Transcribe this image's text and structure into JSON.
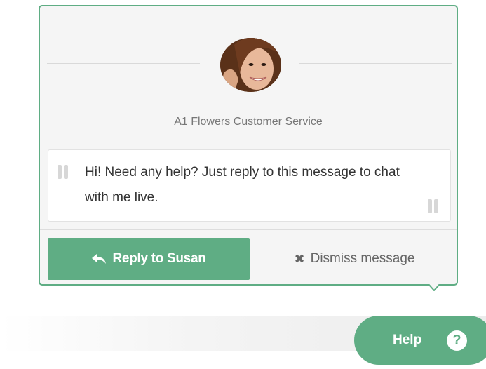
{
  "chat": {
    "agent_name": "A1 Flowers Customer Service",
    "message": "Hi! Need any help? Just reply to this message to chat with me live.",
    "reply_label": "Reply to Susan",
    "dismiss_label": "Dismiss message",
    "dismiss_glyph": "✖"
  },
  "help": {
    "label": "Help",
    "icon_glyph": "?"
  },
  "colors": {
    "accent": "#5fad84",
    "card_background": "#f5f5f5",
    "text_muted": "#777777"
  },
  "icons": [
    "avatar-photo",
    "reply-arrow-icon",
    "dismiss-x-icon",
    "question-icon",
    "quote-icon"
  ]
}
